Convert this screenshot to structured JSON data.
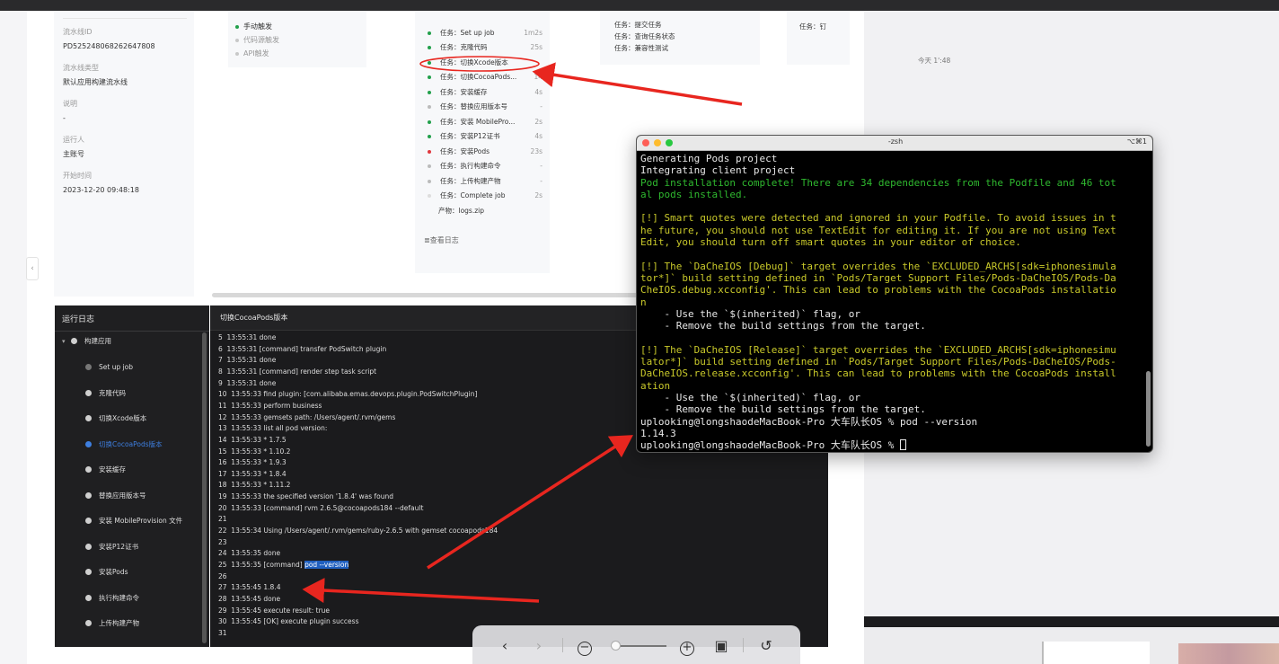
{
  "info": {
    "pipeline_id_label": "流水线ID",
    "pipeline_id_value": "PD52524806826264780​8",
    "pipeline_type_label": "流水线类型",
    "pipeline_type_value": "默认应用构建流水线",
    "desc_label": "说明",
    "desc_value": "-",
    "runner_label": "运行人",
    "runner_value": "主账号",
    "start_time_label": "开始时间",
    "start_time_value": "2023-12-20 09:48:18"
  },
  "triggers": [
    {
      "label": "手动触发",
      "active": true
    },
    {
      "label": "代码源触发",
      "active": false
    },
    {
      "label": "API触发",
      "active": false
    }
  ],
  "tasks": [
    {
      "name": "任务：Set up job",
      "duration": "1m2s",
      "status": "#22a04b"
    },
    {
      "name": "任务：克隆代码",
      "duration": "25s",
      "status": "#22a04b"
    },
    {
      "name": "任务：切换Xcode版本",
      "duration": "",
      "status": "#22a04b"
    },
    {
      "name": "任务：切换CocoaPods...",
      "duration": "14",
      "status": "#22a04b"
    },
    {
      "name": "任务：安装缓存",
      "duration": "4s",
      "status": "#22a04b"
    },
    {
      "name": "任务：替换应用版本号",
      "duration": "-",
      "status": "#bbbbbb"
    },
    {
      "name": "任务：安装 MobilePro...",
      "duration": "2s",
      "status": "#22a04b"
    },
    {
      "name": "任务：安装P12证书",
      "duration": "4s",
      "status": "#22a04b"
    },
    {
      "name": "任务：安装Pods",
      "duration": "23s",
      "status": "#e0383e"
    },
    {
      "name": "任务：执行构建命令",
      "duration": "-",
      "status": "#bbbbbb"
    },
    {
      "name": "任务：上传构建产物",
      "duration": "-",
      "status": "#bbbbbb"
    },
    {
      "name": "任务：Complete job",
      "duration": "2s",
      "status": "#dddddd"
    }
  ],
  "artifact": "产物：logs.zip",
  "view_log": "查看日志",
  "card3": [
    "任务：提交任务",
    "任务：查询任务状态",
    "任务：兼容性测试"
  ],
  "card4": "任务：钉",
  "log": {
    "sidebar_title": "运行日志",
    "build_parent": "构建应用",
    "sidebar_items": [
      {
        "label": "Set up job",
        "active": false
      },
      {
        "label": "克隆代码",
        "active": false
      },
      {
        "label": "切换Xcode版本",
        "active": false
      },
      {
        "label": "切换CocoaPods版本",
        "active": true
      },
      {
        "label": "安装缓存",
        "active": false
      },
      {
        "label": "替换应用版本号",
        "active": false
      },
      {
        "label": "安装 MobileProvision 文件",
        "active": false
      },
      {
        "label": "安装P12证书",
        "active": false
      },
      {
        "label": "安装Pods",
        "active": false
      },
      {
        "label": "执行构建命令",
        "active": false
      },
      {
        "label": "上传构建产物",
        "active": false
      }
    ],
    "main_title": "切换CocoaPods版本",
    "lines": [
      {
        "pre": "5  13:55:31 done",
        "hl": "",
        "post": ""
      },
      {
        "pre": "6  13:55:31 [command] transfer PodSwitch plugin",
        "hl": "",
        "post": ""
      },
      {
        "pre": "7  13:55:31 done",
        "hl": "",
        "post": ""
      },
      {
        "pre": "8  13:55:31 [command] render step task script",
        "hl": "",
        "post": ""
      },
      {
        "pre": "9  13:55:31 done",
        "hl": "",
        "post": ""
      },
      {
        "pre": "10  13:55:33 find plugin: [com.alibaba.emas.devops.plugin.PodSwitchPlugin]",
        "hl": "",
        "post": ""
      },
      {
        "pre": "11  13:55:33 perform business",
        "hl": "",
        "post": ""
      },
      {
        "pre": "12  13:55:33 gemsets path: /Users/agent/.rvm/gems",
        "hl": "",
        "post": ""
      },
      {
        "pre": "13  13:55:33 list all pod version:",
        "hl": "",
        "post": ""
      },
      {
        "pre": "14  13:55:33 * 1.7.5",
        "hl": "",
        "post": ""
      },
      {
        "pre": "15  13:55:33 * 1.10.2",
        "hl": "",
        "post": ""
      },
      {
        "pre": "16  13:55:33 * 1.9.3",
        "hl": "",
        "post": ""
      },
      {
        "pre": "17  13:55:33 * 1.8.4",
        "hl": "",
        "post": ""
      },
      {
        "pre": "18  13:55:33 * 1.11.2",
        "hl": "",
        "post": ""
      },
      {
        "pre": "19  13:55:33 the specified version '1.8.4' was found",
        "hl": "",
        "post": ""
      },
      {
        "pre": "20  13:55:33 [command] rvm 2.6.5@cocoapods184 --default",
        "hl": "",
        "post": ""
      },
      {
        "pre": "21",
        "hl": "",
        "post": ""
      },
      {
        "pre": "22  13:55:34 Using /Users/agent/.rvm/gems/ruby-2.6.5 with gemset cocoapods184",
        "hl": "",
        "post": ""
      },
      {
        "pre": "23",
        "hl": "",
        "post": ""
      },
      {
        "pre": "24  13:55:35 done",
        "hl": "",
        "post": ""
      },
      {
        "pre": "25  13:55:35 [command] ",
        "hl": "pod --version",
        "post": ""
      },
      {
        "pre": "26",
        "hl": "",
        "post": ""
      },
      {
        "pre": "27  13:55:45 1.8.4",
        "hl": "",
        "post": ""
      },
      {
        "pre": "28  13:55:45 done",
        "hl": "",
        "post": ""
      },
      {
        "pre": "29  13:55:45 execute result: true",
        "hl": "",
        "post": ""
      },
      {
        "pre": "30  13:55:45 [OK] execute plugin success",
        "hl": "",
        "post": ""
      },
      {
        "pre": "31",
        "hl": "",
        "post": ""
      }
    ]
  },
  "right_date": "今天 1':48",
  "zoom": {
    "back_icon": "‹",
    "forward_icon": "›",
    "zoom_out_icon": "−",
    "zoom_in_icon": "+",
    "fit_icon": "▣",
    "rotate_icon": "↺",
    "level": 0.05
  },
  "terminal": {
    "title": "-zsh",
    "shortcut": "⌥⌘1",
    "lines": [
      {
        "text": "Generating Pods project",
        "color": "w"
      },
      {
        "text": "Integrating client project",
        "color": "w"
      },
      {
        "text": "Pod installation complete! There are 34 dependencies from the Podfile and 46 tot",
        "color": "g"
      },
      {
        "text": "al pods installed.",
        "color": "g"
      },
      {
        "text": "",
        "color": "w"
      },
      {
        "text": "[!] Smart quotes were detected and ignored in your Podfile. To avoid issues in t",
        "color": "y"
      },
      {
        "text": "he future, you should not use TextEdit for editing it. If you are not using Text",
        "color": "y"
      },
      {
        "text": "Edit, you should turn off smart quotes in your editor of choice.",
        "color": "y"
      },
      {
        "text": "",
        "color": "w"
      },
      {
        "text": "[!] The `DaCheIOS [Debug]` target overrides the `EXCLUDED_ARCHS[sdk=iphonesimula",
        "color": "y"
      },
      {
        "text": "tor*]` build setting defined in `Pods/Target Support Files/Pods-DaCheIOS/Pods-Da",
        "color": "y"
      },
      {
        "text": "CheIOS.debug.xcconfig'. This can lead to problems with the CocoaPods installatio",
        "color": "y"
      },
      {
        "text": "n",
        "color": "y"
      },
      {
        "text": "    - Use the `$(inherited)` flag, or",
        "color": "w"
      },
      {
        "text": "    - Remove the build settings from the target.",
        "color": "w"
      },
      {
        "text": "",
        "color": "w"
      },
      {
        "text": "[!] The `DaCheIOS [Release]` target overrides the `EXCLUDED_ARCHS[sdk=iphonesimu",
        "color": "y"
      },
      {
        "text": "lator*]` build setting defined in `Pods/Target Support Files/Pods-DaCheIOS/Pods-",
        "color": "y"
      },
      {
        "text": "DaCheIOS.release.xcconfig'. This can lead to problems with the CocoaPods install",
        "color": "y"
      },
      {
        "text": "ation",
        "color": "y"
      },
      {
        "text": "    - Use the `$(inherited)` flag, or",
        "color": "w"
      },
      {
        "text": "    - Remove the build settings from the target.",
        "color": "w"
      },
      {
        "text": "uplooking@longshaodeMacBook-Pro 大车队长OS % pod --version",
        "color": "w"
      },
      {
        "text": "1.14.3",
        "color": "w"
      },
      {
        "text": "uplooking@longshaodeMacBook-Pro 大车队长OS % ",
        "color": "w"
      }
    ]
  },
  "colors": {
    "terminal_green": "#2fb92f",
    "terminal_yellow": "#c9c92a",
    "annotation_red": "#e8261f",
    "accent_blue": "#3e7fe0"
  }
}
